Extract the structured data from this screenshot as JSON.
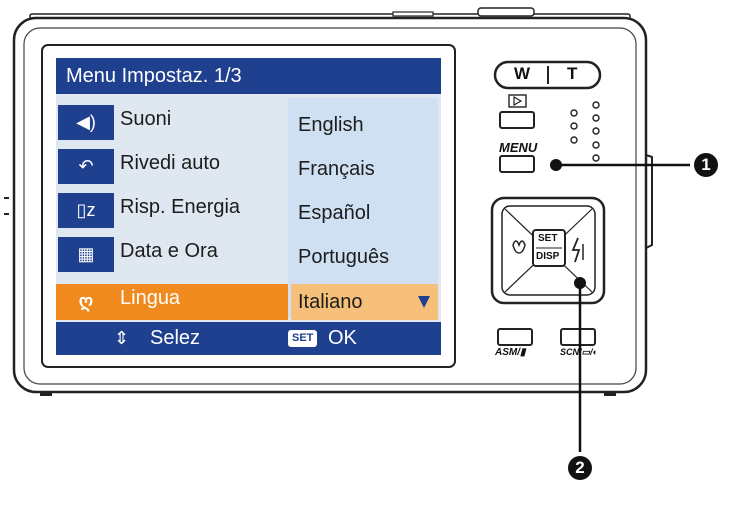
{
  "screen": {
    "title": "Menu Impostaz. 1/3",
    "menu_items": [
      {
        "icon": "speaker-icon",
        "label": "Suoni"
      },
      {
        "icon": "review-icon",
        "label": "Rivedi auto"
      },
      {
        "icon": "power-save-icon",
        "label": "Risp. Energia"
      },
      {
        "icon": "calendar-clock-icon",
        "label": "Data e Ora"
      },
      {
        "icon": "language-icon",
        "icon_text": "ღ",
        "label": "Lingua"
      }
    ],
    "languages": [
      "English",
      "Français",
      "Español",
      "Português",
      "Italiano"
    ],
    "selected_index": 4,
    "footer": {
      "nav_icon": "⇕",
      "nav_label": "Selez",
      "set_badge": "SET",
      "ok_label": "OK"
    }
  },
  "camera": {
    "zoom_w": "W",
    "zoom_t": "T",
    "menu_label": "MENU",
    "set_label": "SET",
    "disp_label": "DISP",
    "asm_label": "ASM/▮",
    "scn_label": "SCN/▭/◐"
  },
  "callouts": [
    "1",
    "2"
  ],
  "colors": {
    "screen_blue": "#1f3f8f",
    "highlight_orange": "#f08a1e",
    "option_bg": "#cfe0f2",
    "screen_bg": "#dfe7f1"
  }
}
